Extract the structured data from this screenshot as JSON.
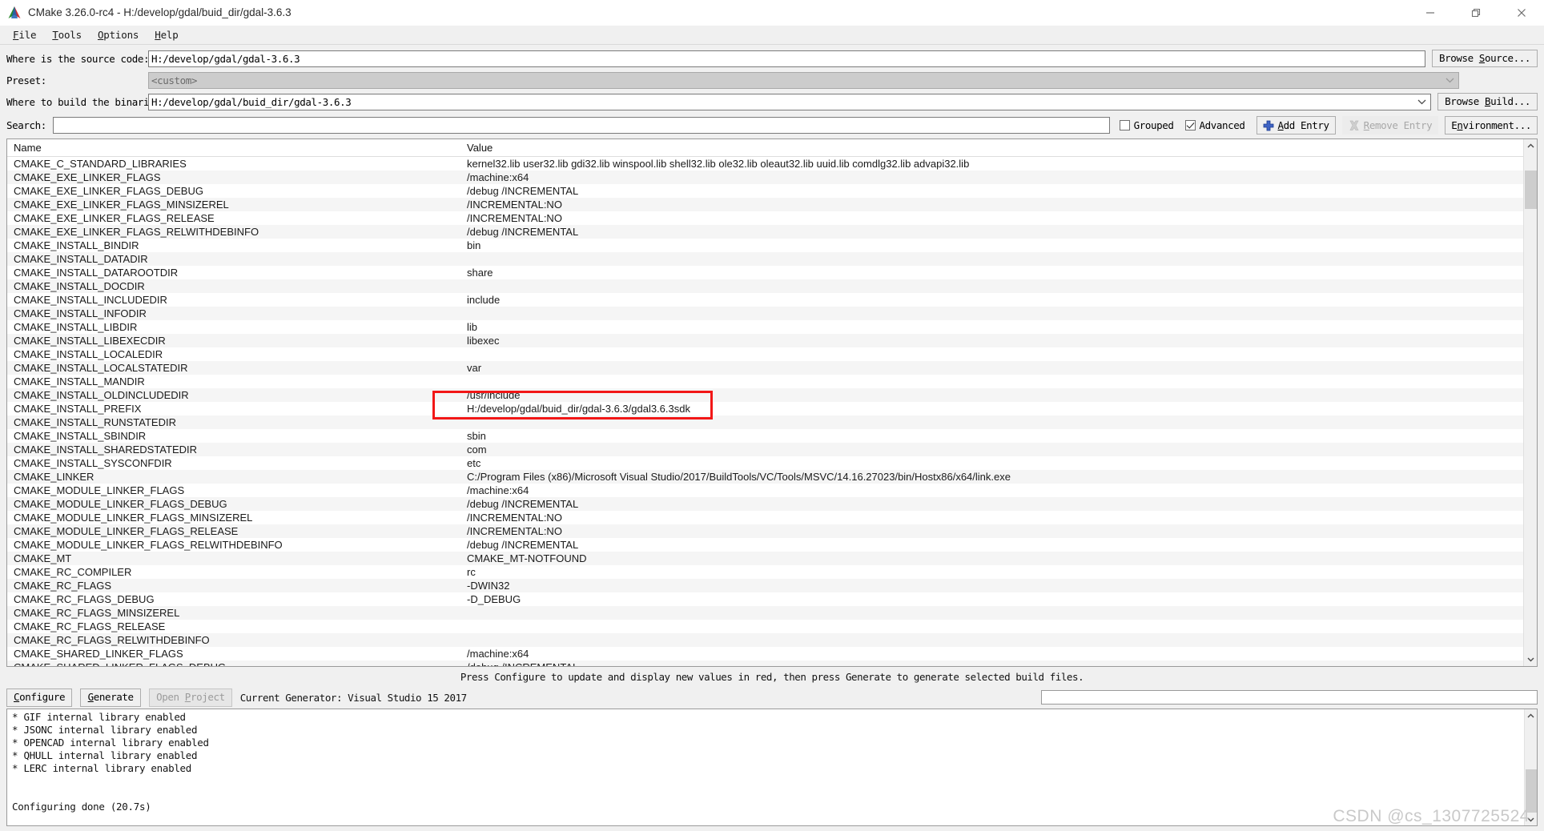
{
  "window": {
    "title": "CMake 3.26.0-rc4 - H:/develop/gdal/buid_dir/gdal-3.6.3",
    "app_icon": "cmake-logo-icon",
    "minimize_label": "—",
    "maximize_label": "❐",
    "close_label": "✕"
  },
  "menu": [
    {
      "label": "File",
      "mnemonic": "F"
    },
    {
      "label": "Tools",
      "mnemonic": "T"
    },
    {
      "label": "Options",
      "mnemonic": "O"
    },
    {
      "label": "Help",
      "mnemonic": "H"
    }
  ],
  "form": {
    "source_label": "Where is the source code:",
    "source_value": "H:/develop/gdal/gdal-3.6.3",
    "browse_source_label": "Browse Source...",
    "preset_label": "Preset:",
    "preset_value": "<custom>",
    "build_label": "Where to build the binaries:",
    "build_value": "H:/develop/gdal/buid_dir/gdal-3.6.3",
    "browse_build_label": "Browse Build..."
  },
  "search": {
    "label": "Search:",
    "value": "",
    "placeholder": "",
    "grouped_label": "Grouped",
    "grouped_checked": false,
    "advanced_label": "Advanced",
    "advanced_checked": true,
    "add_entry_label": "Add Entry",
    "remove_entry_label": "Remove Entry",
    "remove_entry_enabled": false,
    "environment_label": "Environment..."
  },
  "table": {
    "columns": [
      "Name",
      "Value"
    ],
    "rows": [
      {
        "name": "CMAKE_C_STANDARD_LIBRARIES",
        "value": "kernel32.lib user32.lib gdi32.lib winspool.lib shell32.lib ole32.lib oleaut32.lib uuid.lib comdlg32.lib advapi32.lib"
      },
      {
        "name": "CMAKE_EXE_LINKER_FLAGS",
        "value": "/machine:x64"
      },
      {
        "name": "CMAKE_EXE_LINKER_FLAGS_DEBUG",
        "value": "/debug /INCREMENTAL"
      },
      {
        "name": "CMAKE_EXE_LINKER_FLAGS_MINSIZEREL",
        "value": "/INCREMENTAL:NO"
      },
      {
        "name": "CMAKE_EXE_LINKER_FLAGS_RELEASE",
        "value": "/INCREMENTAL:NO"
      },
      {
        "name": "CMAKE_EXE_LINKER_FLAGS_RELWITHDEBINFO",
        "value": "/debug /INCREMENTAL"
      },
      {
        "name": "CMAKE_INSTALL_BINDIR",
        "value": "bin"
      },
      {
        "name": "CMAKE_INSTALL_DATADIR",
        "value": ""
      },
      {
        "name": "CMAKE_INSTALL_DATAROOTDIR",
        "value": "share"
      },
      {
        "name": "CMAKE_INSTALL_DOCDIR",
        "value": ""
      },
      {
        "name": "CMAKE_INSTALL_INCLUDEDIR",
        "value": "include"
      },
      {
        "name": "CMAKE_INSTALL_INFODIR",
        "value": ""
      },
      {
        "name": "CMAKE_INSTALL_LIBDIR",
        "value": "lib"
      },
      {
        "name": "CMAKE_INSTALL_LIBEXECDIR",
        "value": "libexec"
      },
      {
        "name": "CMAKE_INSTALL_LOCALEDIR",
        "value": ""
      },
      {
        "name": "CMAKE_INSTALL_LOCALSTATEDIR",
        "value": "var"
      },
      {
        "name": "CMAKE_INSTALL_MANDIR",
        "value": ""
      },
      {
        "name": "CMAKE_INSTALL_OLDINCLUDEDIR",
        "value": "/usr/include"
      },
      {
        "name": "CMAKE_INSTALL_PREFIX",
        "value": "H:/develop/gdal/buid_dir/gdal-3.6.3/gdal3.6.3sdk"
      },
      {
        "name": "CMAKE_INSTALL_RUNSTATEDIR",
        "value": ""
      },
      {
        "name": "CMAKE_INSTALL_SBINDIR",
        "value": "sbin"
      },
      {
        "name": "CMAKE_INSTALL_SHAREDSTATEDIR",
        "value": "com"
      },
      {
        "name": "CMAKE_INSTALL_SYSCONFDIR",
        "value": "etc"
      },
      {
        "name": "CMAKE_LINKER",
        "value": "C:/Program Files (x86)/Microsoft Visual Studio/2017/BuildTools/VC/Tools/MSVC/14.16.27023/bin/Hostx86/x64/link.exe"
      },
      {
        "name": "CMAKE_MODULE_LINKER_FLAGS",
        "value": "/machine:x64"
      },
      {
        "name": "CMAKE_MODULE_LINKER_FLAGS_DEBUG",
        "value": "/debug /INCREMENTAL"
      },
      {
        "name": "CMAKE_MODULE_LINKER_FLAGS_MINSIZEREL",
        "value": "/INCREMENTAL:NO"
      },
      {
        "name": "CMAKE_MODULE_LINKER_FLAGS_RELEASE",
        "value": "/INCREMENTAL:NO"
      },
      {
        "name": "CMAKE_MODULE_LINKER_FLAGS_RELWITHDEBINFO",
        "value": "/debug /INCREMENTAL"
      },
      {
        "name": "CMAKE_MT",
        "value": "CMAKE_MT-NOTFOUND"
      },
      {
        "name": "CMAKE_RC_COMPILER",
        "value": "rc"
      },
      {
        "name": "CMAKE_RC_FLAGS",
        "value": "-DWIN32"
      },
      {
        "name": "CMAKE_RC_FLAGS_DEBUG",
        "value": "-D_DEBUG"
      },
      {
        "name": "CMAKE_RC_FLAGS_MINSIZEREL",
        "value": ""
      },
      {
        "name": "CMAKE_RC_FLAGS_RELEASE",
        "value": ""
      },
      {
        "name": "CMAKE_RC_FLAGS_RELWITHDEBINFO",
        "value": ""
      },
      {
        "name": "CMAKE_SHARED_LINKER_FLAGS",
        "value": "/machine:x64"
      },
      {
        "name": "CMAKE_SHARED_LINKER_FLAGS_DEBUG",
        "value": "/debug /INCREMENTAL"
      }
    ]
  },
  "hint": "Press Configure to update and display new values in red, then press Generate to generate selected build files.",
  "actions": {
    "configure_label": "Configure",
    "generate_label": "Generate",
    "open_project_label": "Open Project",
    "open_project_enabled": false,
    "generator_text": "Current Generator: Visual Studio 15 2017"
  },
  "log": {
    "lines": [
      "* GIF internal library enabled",
      "* JSONC internal library enabled",
      "* OPENCAD internal library enabled",
      "* QHULL internal library enabled",
      "* LERC internal library enabled",
      "",
      "",
      "Configuring done (20.7s)"
    ]
  },
  "annotation": {
    "highlight_target": "CMAKE_INSTALL_PREFIX",
    "color": "#f21717"
  },
  "watermark": "CSDN @cs_1307725524"
}
